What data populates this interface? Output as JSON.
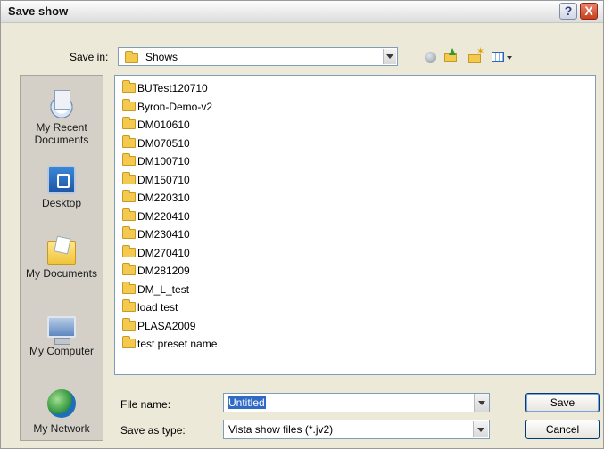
{
  "window": {
    "title": "Save show",
    "help_glyph": "?",
    "close_glyph": "X"
  },
  "save_in": {
    "label": "Save in:",
    "value": "Shows"
  },
  "toolbar": {
    "icons": [
      "back-icon",
      "up-folder-icon",
      "new-folder-icon",
      "views-menu-icon"
    ]
  },
  "places": [
    {
      "label": "My Recent Documents",
      "icon": "recent-documents-icon"
    },
    {
      "label": "Desktop",
      "icon": "desktop-icon"
    },
    {
      "label": "My Documents",
      "icon": "my-documents-icon"
    },
    {
      "label": "My Computer",
      "icon": "my-computer-icon"
    },
    {
      "label": "My Network",
      "icon": "my-network-icon"
    }
  ],
  "files": [
    "BUTest120710",
    "Byron-Demo-v2",
    "DM010610",
    "DM070510",
    "DM100710",
    "DM150710",
    "DM220310",
    "DM220410",
    "DM230410",
    "DM270410",
    "DM281209",
    "DM_L_test",
    "load test",
    "PLASA2009",
    "test preset name"
  ],
  "file_name": {
    "label": "File name:",
    "value": "Untitled"
  },
  "save_as_type": {
    "label": "Save as type:",
    "value": "Vista show files (*.jv2)"
  },
  "buttons": {
    "save": "Save",
    "cancel": "Cancel"
  },
  "colors": {
    "selection": "#316ac5",
    "folder": "#f3c94f",
    "border": "#7f9db9"
  }
}
